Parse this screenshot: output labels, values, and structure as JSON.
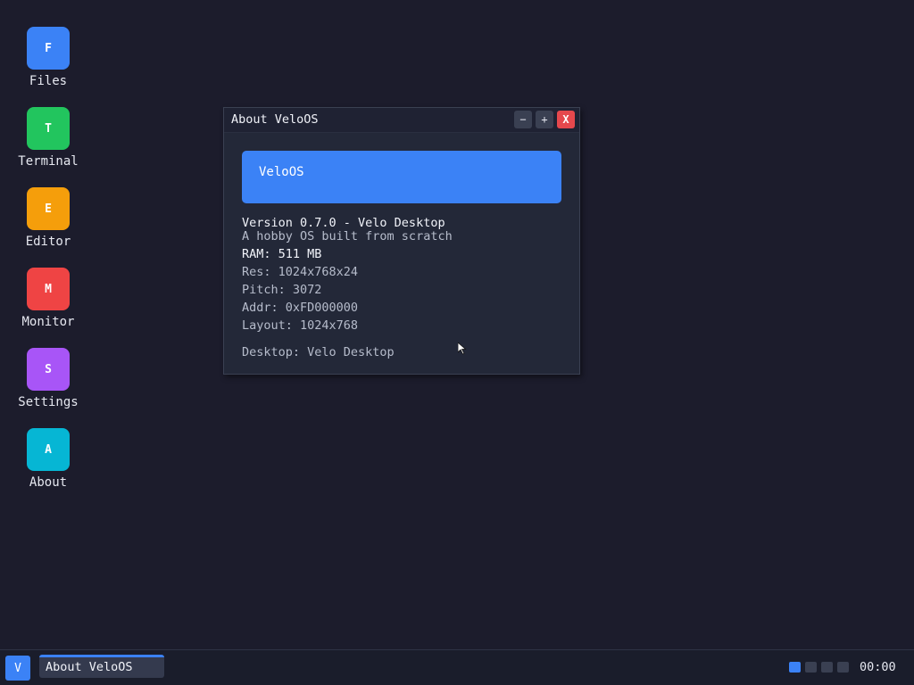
{
  "desktop_icons": [
    {
      "letter": "F",
      "label": "Files",
      "color": "#3b82f6"
    },
    {
      "letter": "T",
      "label": "Terminal",
      "color": "#22c55e"
    },
    {
      "letter": "E",
      "label": "Editor",
      "color": "#f59e0b"
    },
    {
      "letter": "M",
      "label": "Monitor",
      "color": "#ef4444"
    },
    {
      "letter": "S",
      "label": "Settings",
      "color": "#a855f7"
    },
    {
      "letter": "A",
      "label": "About",
      "color": "#06b6d4"
    }
  ],
  "window": {
    "title": "About VeloOS",
    "minimize_label": "−",
    "maximize_label": "+",
    "close_label": "X",
    "banner_text": "VeloOS",
    "version": "Version 0.7.0 - Velo Desktop",
    "tagline": "A hobby OS built from scratch",
    "ram": "RAM: 511 MB",
    "res": "Res: 1024x768x24",
    "pitch": "Pitch: 3072",
    "addr": "Addr: 0xFD000000",
    "layout": "Layout: 1024x768",
    "desktop": "Desktop: Velo Desktop"
  },
  "taskbar": {
    "start_label": "V",
    "task_label": "About VeloOS",
    "workspaces": [
      {
        "active": true
      },
      {
        "active": false
      },
      {
        "active": false
      },
      {
        "active": false
      }
    ],
    "clock": "00:00"
  },
  "colors": {
    "accent": "#3b82f6",
    "close": "#e5484d",
    "desktop_bg": "#1c1c2c"
  }
}
